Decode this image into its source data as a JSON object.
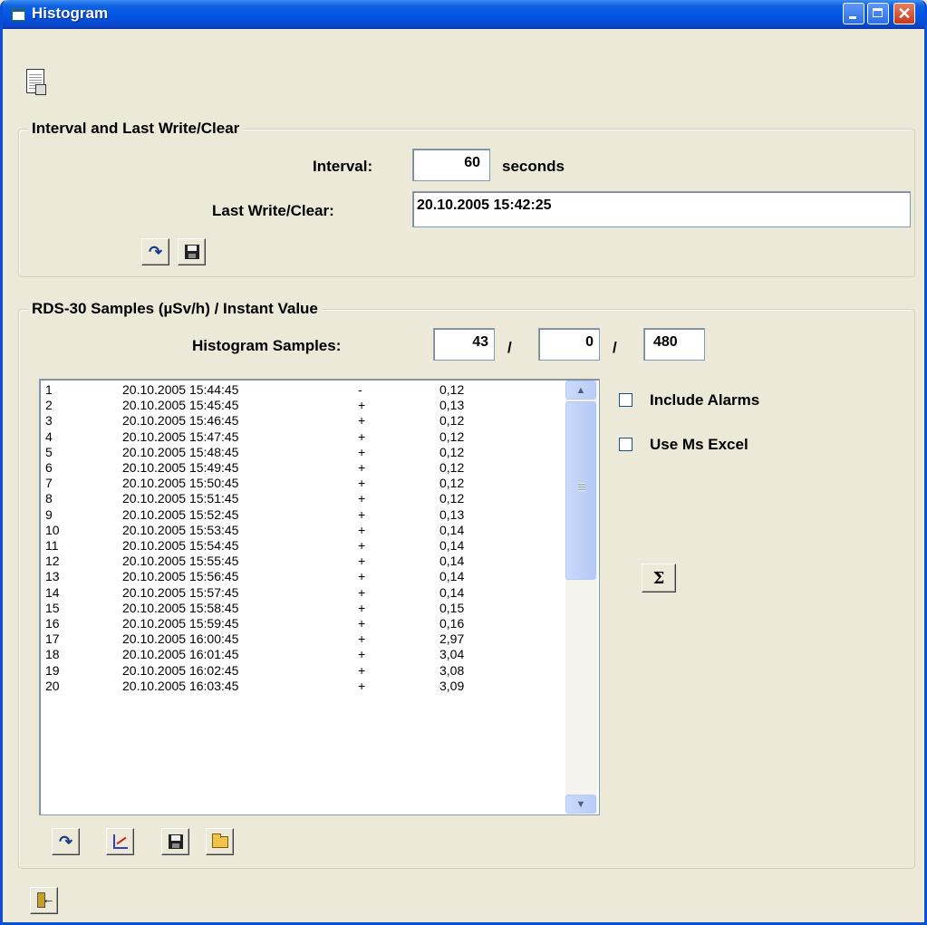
{
  "window": {
    "title": "Histogram"
  },
  "interval_group": {
    "legend": "Interval and Last Write/Clear",
    "interval_label": "Interval:",
    "interval_value": "60",
    "interval_unit": "seconds",
    "last_label": "Last Write/Clear:",
    "last_value": "20.10.2005 15:42:25"
  },
  "samples_group": {
    "legend": "RDS-30 Samples (µSv/h) / Instant Value",
    "hist_label": "Histogram Samples:",
    "hist_values": [
      "43",
      "0",
      "480"
    ],
    "sep": "/",
    "rows": [
      [
        "1",
        "20.10.2005 15:44:45",
        "-",
        "0,12"
      ],
      [
        "2",
        "20.10.2005 15:45:45",
        "+",
        "0,13"
      ],
      [
        "3",
        "20.10.2005 15:46:45",
        "+",
        "0,12"
      ],
      [
        "4",
        "20.10.2005 15:47:45",
        "+",
        "0,12"
      ],
      [
        "5",
        "20.10.2005 15:48:45",
        "+",
        "0,12"
      ],
      [
        "6",
        "20.10.2005 15:49:45",
        "+",
        "0,12"
      ],
      [
        "7",
        "20.10.2005 15:50:45",
        "+",
        "0,12"
      ],
      [
        "8",
        "20.10.2005 15:51:45",
        "+",
        "0,12"
      ],
      [
        "9",
        "20.10.2005 15:52:45",
        "+",
        "0,13"
      ],
      [
        "10",
        "20.10.2005 15:53:45",
        "+",
        "0,14"
      ],
      [
        "11",
        "20.10.2005 15:54:45",
        "+",
        "0,14"
      ],
      [
        "12",
        "20.10.2005 15:55:45",
        "+",
        "0,14"
      ],
      [
        "13",
        "20.10.2005 15:56:45",
        "+",
        "0,14"
      ],
      [
        "14",
        "20.10.2005 15:57:45",
        "+",
        "0,14"
      ],
      [
        "15",
        "20.10.2005 15:58:45",
        "+",
        "0,15"
      ],
      [
        "16",
        "20.10.2005 15:59:45",
        "+",
        "0,16"
      ],
      [
        "17",
        "20.10.2005 16:00:45",
        "+",
        "2,97"
      ],
      [
        "18",
        "20.10.2005 16:01:45",
        "+",
        "3,04"
      ],
      [
        "19",
        "20.10.2005 16:02:45",
        "+",
        "3,08"
      ],
      [
        "20",
        "20.10.2005 16:03:45",
        "+",
        "3,09"
      ]
    ],
    "include_alarms": "Include Alarms",
    "use_excel": "Use Ms Excel",
    "sigma": "Σ"
  }
}
